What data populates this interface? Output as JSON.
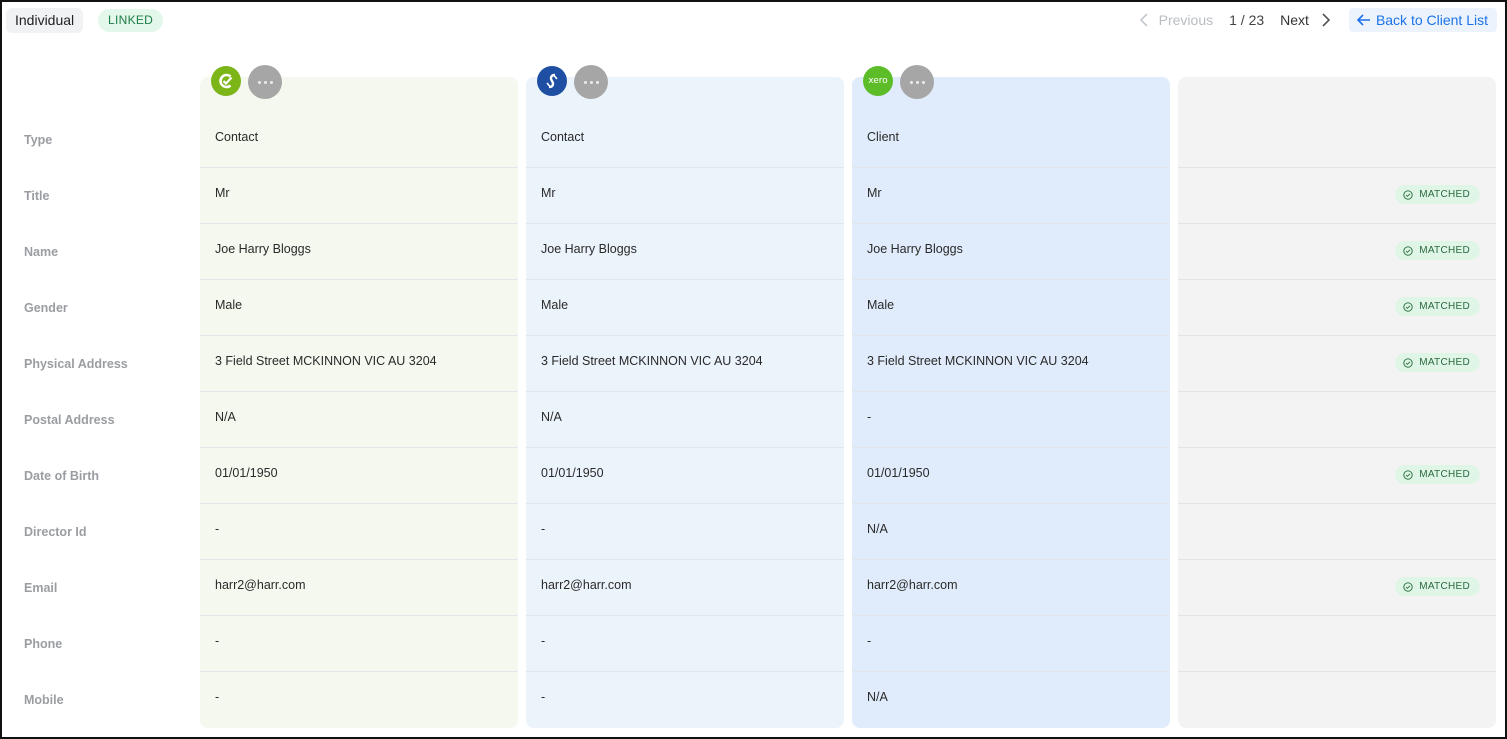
{
  "header": {
    "type_tag": "Individual",
    "status_tag": "LINKED",
    "pagination": {
      "previous_label": "Previous",
      "count": "1 / 23",
      "next_label": "Next",
      "back_label": "Back to Client List"
    }
  },
  "fields": [
    "Type",
    "Title",
    "Name",
    "Gender",
    "Physical Address",
    "Postal Address",
    "Date of Birth",
    "Director Id",
    "Email",
    "Phone",
    "Mobile"
  ],
  "sources": [
    {
      "icon": "checkmark-c-logo-icon",
      "color": "#7cb518",
      "values": [
        "Contact",
        "Mr",
        "Joe Harry Bloggs",
        "Male",
        "3 Field Street MCKINNON VIC AU 3204",
        "N/A",
        "01/01/1950",
        "-",
        "harr2@harr.com",
        "-",
        "-"
      ]
    },
    {
      "icon": "link-s-logo-icon",
      "color": "#1e4fa3",
      "values": [
        "Contact",
        "Mr",
        "Joe Harry Bloggs",
        "Male",
        "3 Field Street MCKINNON VIC AU 3204",
        "N/A",
        "01/01/1950",
        "-",
        "harr2@harr.com",
        "-",
        "-"
      ]
    },
    {
      "icon": "xero-logo-icon",
      "logo_text": "xero",
      "color": "#5cbd29",
      "values": [
        "Client",
        "Mr",
        "Joe Harry Bloggs",
        "Male",
        "3 Field Street MCKINNON VIC AU 3204",
        "-",
        "01/01/1950",
        "N/A",
        "harr2@harr.com",
        "-",
        "N/A"
      ]
    }
  ],
  "match": {
    "label": "MATCHED",
    "rows": [
      "",
      "MATCHED",
      "MATCHED",
      "MATCHED",
      "MATCHED",
      "",
      "MATCHED",
      "",
      "MATCHED",
      "",
      ""
    ]
  },
  "colors": {
    "accent": "#1a73e8",
    "matched_bg": "#dff5e6",
    "linked_bg": "#e3f7ea"
  }
}
